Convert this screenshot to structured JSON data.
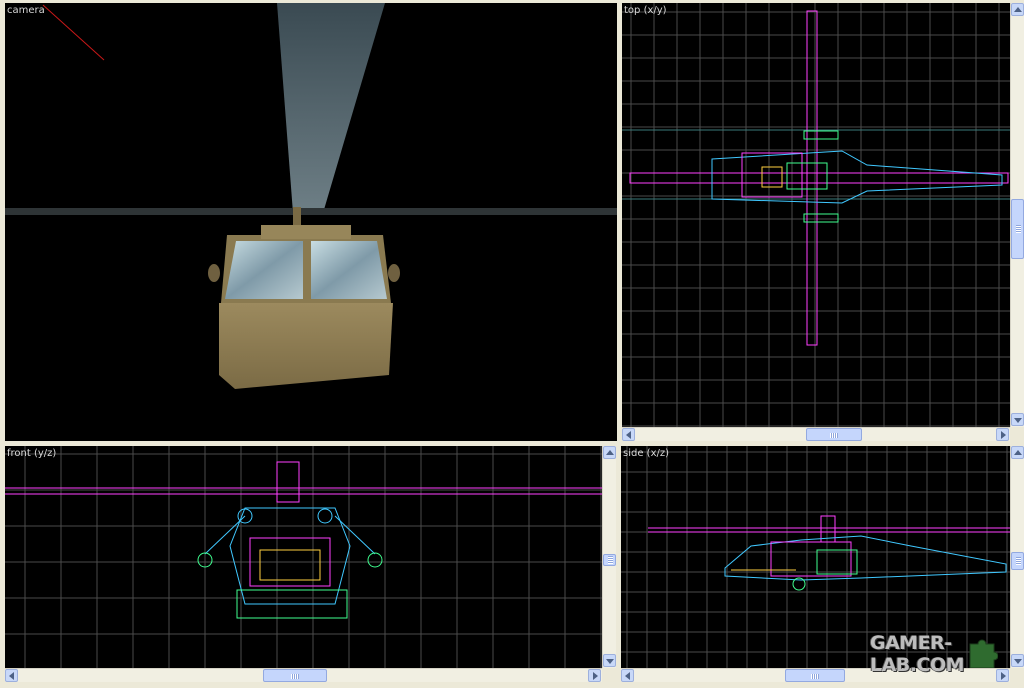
{
  "viewports": {
    "camera": {
      "label": "camera"
    },
    "top": {
      "label": "top (x/y)"
    },
    "front": {
      "label": "front (y/z)"
    },
    "side": {
      "label": "side (x/z)"
    }
  },
  "watermark": {
    "text": "GAMER-LAB.COM",
    "icon": "puzzle-piece-icon"
  },
  "colors": {
    "grid": "#4a4a4a",
    "axis": "#3a7a7a",
    "selected": "#ff40ff",
    "wire_cyan": "#40c8ff",
    "wire_green": "#40ff90",
    "wire_white": "#e0e0e0",
    "wire_yellow": "#ffd040",
    "scrollbar_thumb": "#c5d6fc"
  },
  "icons": {
    "scroll_up": "arrow-up-icon",
    "scroll_down": "arrow-down-icon",
    "scroll_left": "arrow-left-icon",
    "scroll_right": "arrow-right-icon"
  }
}
